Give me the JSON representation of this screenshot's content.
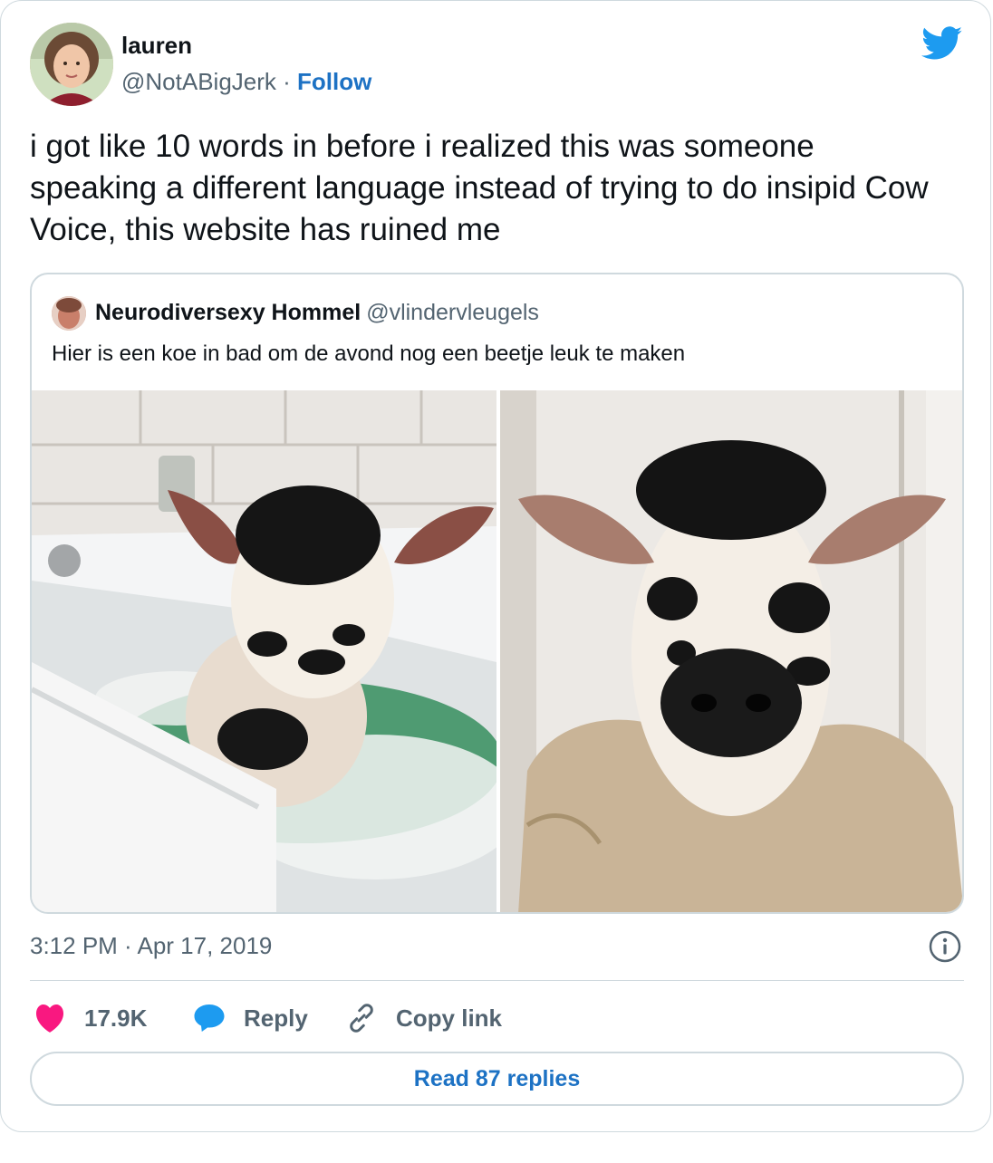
{
  "author": {
    "name": "lauren",
    "handle": "@NotABigJerk",
    "separator": "·",
    "follow_label": "Follow"
  },
  "tweet_text": "i got like 10 words in before i realized this was someone speaking a different language instead of trying to do insipid Cow Voice, this website has ruined me",
  "quoted": {
    "name": "Neurodiversexy Hommel",
    "handle": "@vlindervleugels",
    "text": "Hier is een koe in bad om de avond nog een beetje leuk te maken"
  },
  "timestamp": "3:12 PM · Apr 17, 2019",
  "actions": {
    "likes": "17.9K",
    "reply_label": "Reply",
    "copy_label": "Copy link"
  },
  "read_replies_label": "Read 87 replies",
  "colors": {
    "brand_blue": "#1d9bf0",
    "link_blue": "#1d72c4",
    "heart_pink": "#f91880",
    "muted_text": "#536471",
    "border": "#cfd9de"
  },
  "icons": [
    "twitter-bird-icon",
    "info-icon",
    "heart-icon",
    "reply-bubble-icon",
    "link-icon"
  ]
}
